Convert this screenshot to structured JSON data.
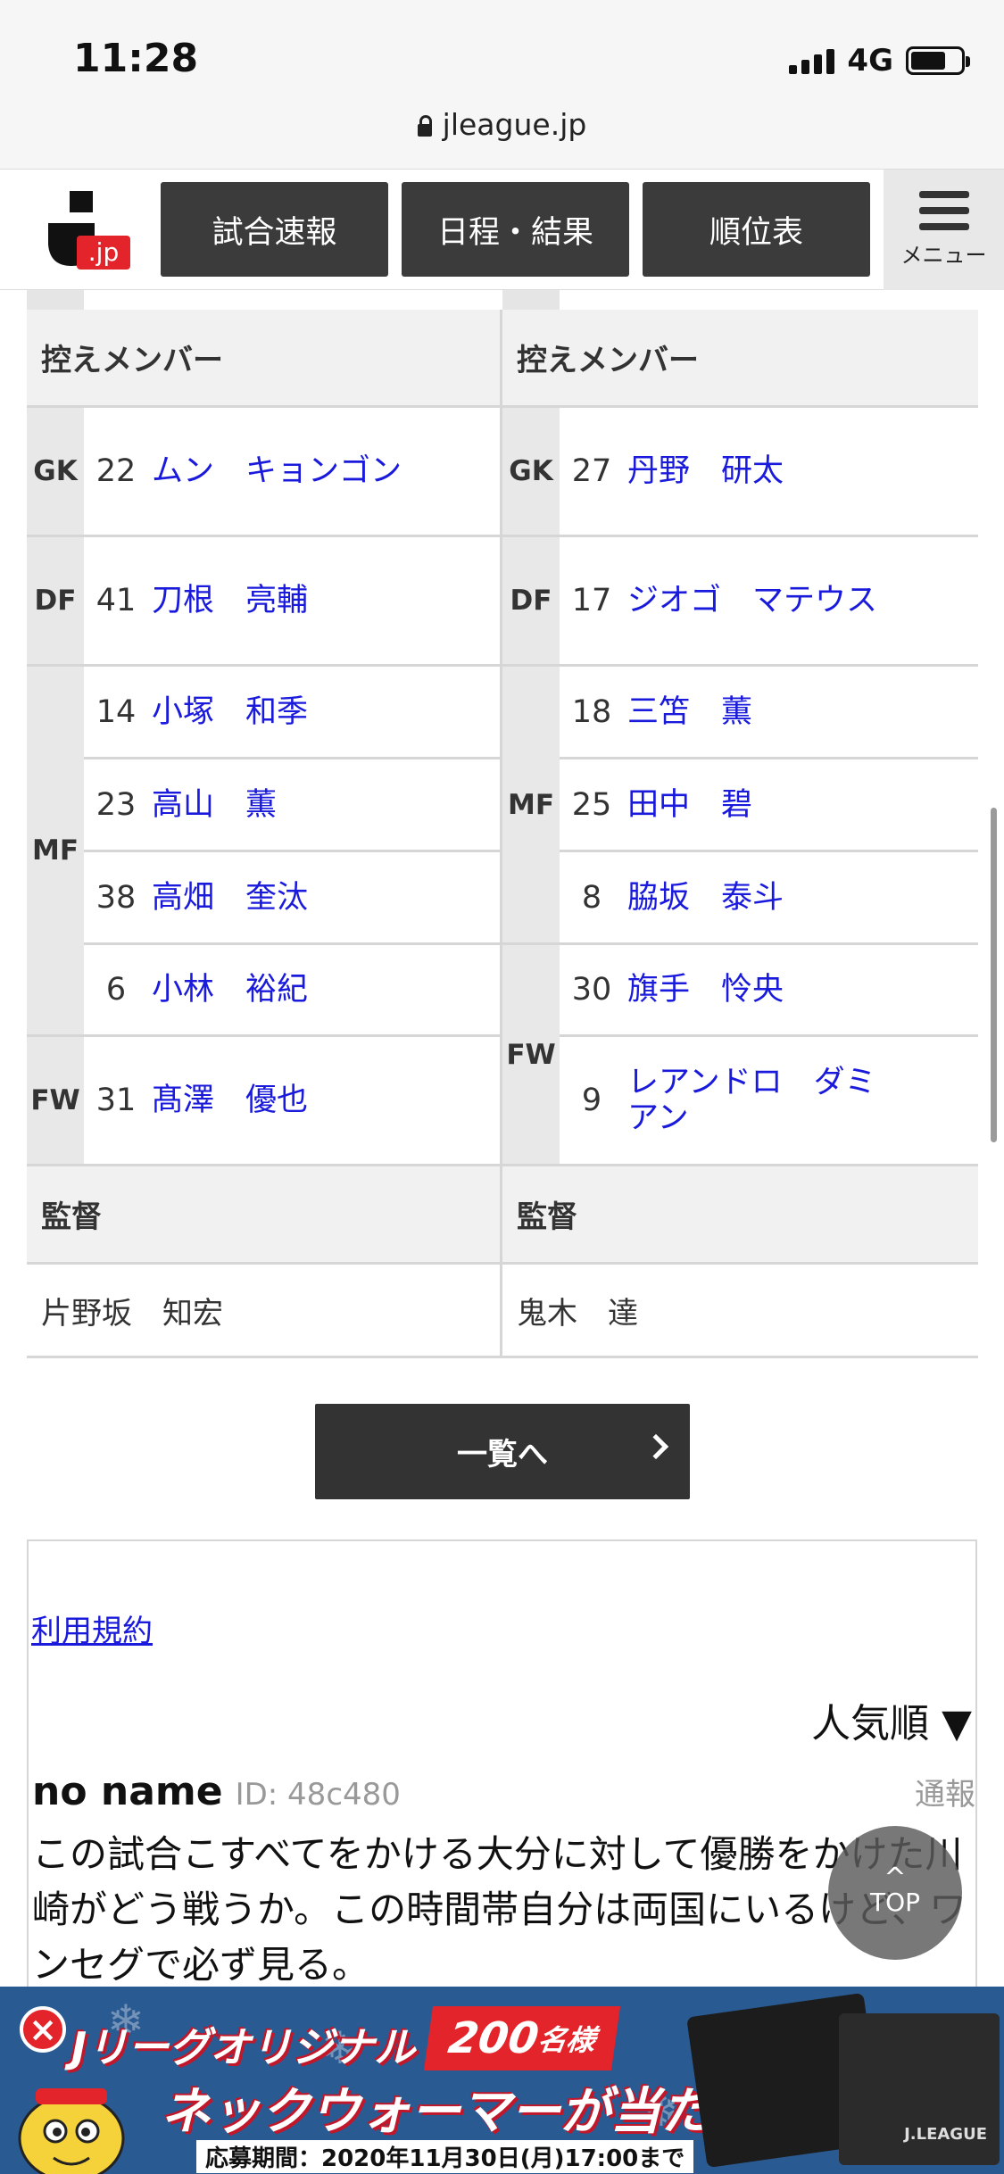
{
  "status_bar": {
    "time": "11:28",
    "network": "4G"
  },
  "browser": {
    "url": "jleague.jp"
  },
  "header": {
    "logo_text": ".jp",
    "nav": [
      "試合速報",
      "日程・結果",
      "順位表"
    ],
    "menu_label": "メニュー"
  },
  "lineup": {
    "subs_heading": "控えメンバー",
    "manager_heading": "監督",
    "home": {
      "gk": [
        {
          "num": "22",
          "name": "ムン　キョンゴン"
        }
      ],
      "df": [
        {
          "num": "41",
          "name": "刀根　亮輔"
        }
      ],
      "mf": [
        {
          "num": "14",
          "name": "小塚　和季"
        },
        {
          "num": "23",
          "name": "高山　薫"
        },
        {
          "num": "38",
          "name": "高畑　奎汰"
        },
        {
          "num": "6",
          "name": "小林　裕紀"
        }
      ],
      "fw": [
        {
          "num": "31",
          "name": "髙澤　優也"
        }
      ],
      "manager": "片野坂　知宏"
    },
    "away": {
      "gk": [
        {
          "num": "27",
          "name": "丹野　研太"
        }
      ],
      "df": [
        {
          "num": "17",
          "name": "ジオゴ　マテウス"
        }
      ],
      "mf": [
        {
          "num": "18",
          "name": "三笘　薫"
        },
        {
          "num": "25",
          "name": "田中　碧"
        },
        {
          "num": "8",
          "name": "脇坂　泰斗"
        }
      ],
      "fw": [
        {
          "num": "30",
          "name": "旗手　怜央"
        },
        {
          "num": "9",
          "name": "レアンドロ　ダミアン"
        }
      ],
      "manager": "鬼木　達"
    },
    "positions": {
      "gk": "GK",
      "df": "DF",
      "mf": "MF",
      "fw": "FW"
    }
  },
  "list_button": "一覧へ",
  "comments": {
    "terms_link": "利用規約",
    "sort_label": "人気順 ▼",
    "report_label": "通報",
    "items": [
      {
        "author": "no name",
        "id": "ID: 48c480",
        "text": "この試合こすべてをかける大分に対して優勝をかけた川崎がどう戦うか。この時間帯自分は両国にいるけど、ワンセグで必ず見る。"
      }
    ]
  },
  "top_button": "TOP",
  "ad": {
    "line1": "Jリーグオリジナル",
    "badge_num": "200",
    "badge_unit": "名様",
    "line2": "ネックウォーマーが当たる!",
    "line3": "応募期間：2020年11月30日(月)17:00まで",
    "product_brand": "J.LEAGUE"
  },
  "colors": {
    "nav_bg": "#3b3b3b",
    "link": "#1a1adc",
    "ad_bg": "#2a5a92",
    "ad_red": "#e3242b"
  }
}
